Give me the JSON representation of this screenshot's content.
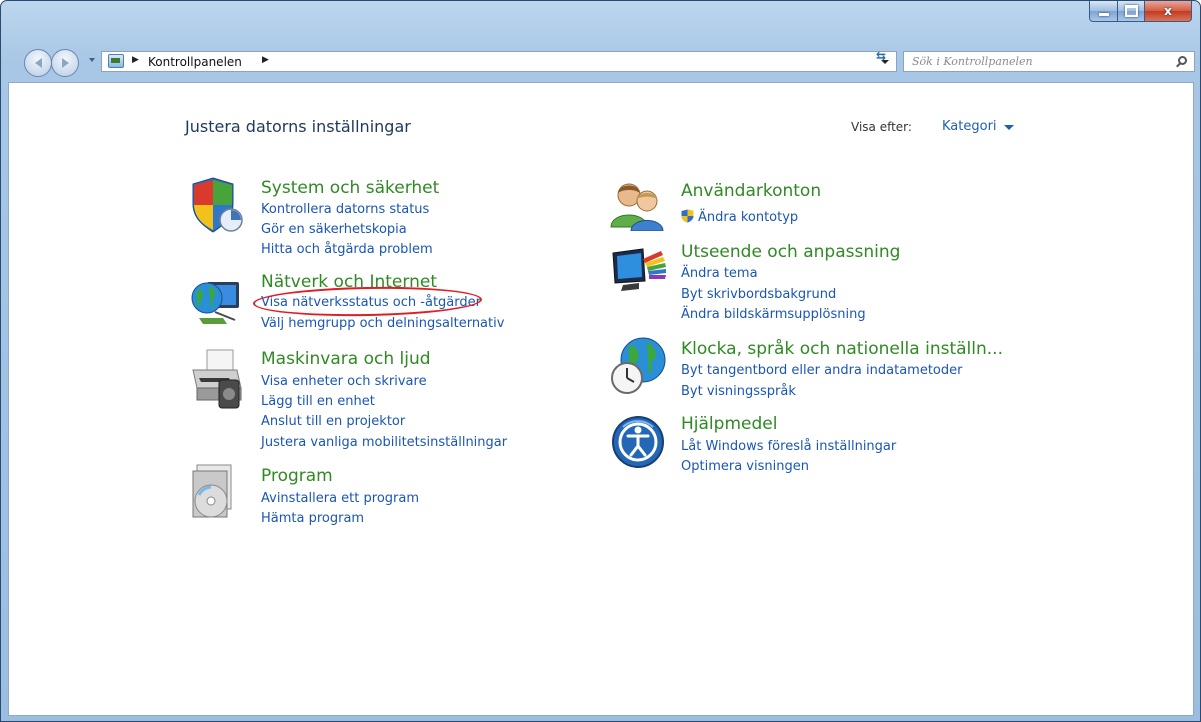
{
  "window": {
    "caption": {
      "minimize_glyph": "minimize-icon",
      "maximize_glyph": "maximize-icon",
      "close_glyph": "x"
    }
  },
  "nav": {
    "breadcrumb": "Kontrollpanelen",
    "search_placeholder": "Sök i Kontrollpanelen"
  },
  "page": {
    "title": "Justera datorns inställningar",
    "view_label": "Visa efter:",
    "view_value": "Kategori"
  },
  "categories": {
    "system": {
      "title": "System och säkerhet",
      "links": [
        "Kontrollera datorns status",
        "Gör en säkerhetskopia",
        "Hitta och åtgärda problem"
      ]
    },
    "network": {
      "title": "Nätverk och Internet",
      "links": [
        "Visa nätverksstatus och -åtgärder",
        "Välj hemgrupp och delningsalternativ"
      ]
    },
    "hardware": {
      "title": "Maskinvara och ljud",
      "links": [
        "Visa enheter och skrivare",
        "Lägg till en enhet",
        "Anslut till en projektor",
        "Justera vanliga mobilitetsinställningar"
      ]
    },
    "programs": {
      "title": "Program",
      "links": [
        "Avinstallera ett program",
        "Hämta program"
      ]
    },
    "accounts": {
      "title": "Användarkonton",
      "links": [
        "Ändra kontotyp"
      ]
    },
    "appearance": {
      "title": "Utseende och anpassning",
      "links": [
        "Ändra tema",
        "Byt skrivbordsbakgrund",
        "Ändra bildskärmsupplösning"
      ]
    },
    "clock": {
      "title": "Klocka, språk och nationella inställn...",
      "links": [
        "Byt tangentbord eller andra indatametoder",
        "Byt visningsspråk"
      ]
    },
    "access": {
      "title": "Hjälpmedel",
      "links": [
        "Låt Windows föreslå inställningar",
        "Optimera visningen"
      ]
    }
  },
  "colors": {
    "category_green": "#2f8a23",
    "link_blue": "#1a56b5",
    "highlight_red": "#e01d25"
  }
}
